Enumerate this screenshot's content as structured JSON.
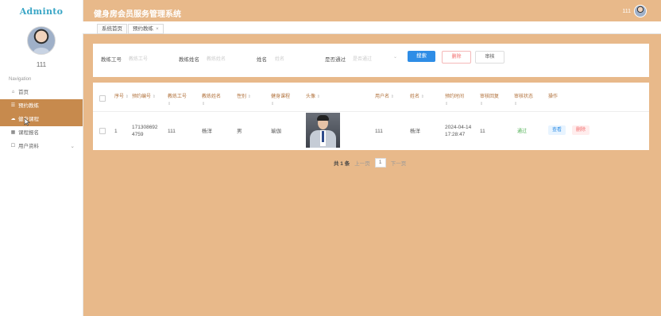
{
  "logo": "Adminto",
  "title": "健身房会员服务管理系统",
  "user": {
    "name": "111"
  },
  "sidebar": {
    "section_label": "Navigation",
    "items": [
      {
        "label": "首页",
        "icon": "home-icon"
      },
      {
        "label": "预约教练",
        "icon": "list-icon"
      },
      {
        "label": "健身课程",
        "icon": "cloud-icon"
      },
      {
        "label": "课程报名",
        "icon": "grid-icon"
      },
      {
        "label": "用户资料",
        "icon": "user-icon"
      }
    ]
  },
  "tabs": [
    {
      "label": "系统首页"
    },
    {
      "label": "预约教练",
      "close": "×"
    }
  ],
  "search": {
    "fields": [
      {
        "label": "教练工号",
        "placeholder": "教练工号"
      },
      {
        "label": "教练姓名",
        "placeholder": "教练姓名"
      },
      {
        "label": "姓名",
        "placeholder": "姓名"
      },
      {
        "label": "是否通过",
        "placeholder": "是否通过"
      }
    ],
    "search_button": "搜索",
    "delete_button": "删除",
    "audit_button": "审核"
  },
  "table": {
    "headers": [
      "序号",
      "预约编号",
      "教练工号",
      "教练姓名",
      "性别",
      "健身课程",
      "头像",
      "用户名",
      "姓名",
      "预约时间",
      "审核回复",
      "审核状态",
      "操作"
    ],
    "rows": [
      {
        "index": "1",
        "order_no_line1": "171308692",
        "order_no_line2": "4759",
        "coach_id": "111",
        "coach_name": "杨洋",
        "gender": "男",
        "course": "瑜伽",
        "username": "111",
        "name": "杨洋",
        "time_line1": "2024-04-14",
        "time_line2": "17:28:47",
        "reply": "11",
        "status": "通过",
        "view": "查看",
        "delete": "删除"
      }
    ]
  },
  "pager": {
    "total": "共 1 条",
    "prev": "上一页",
    "current": "1",
    "next": "下一页"
  }
}
